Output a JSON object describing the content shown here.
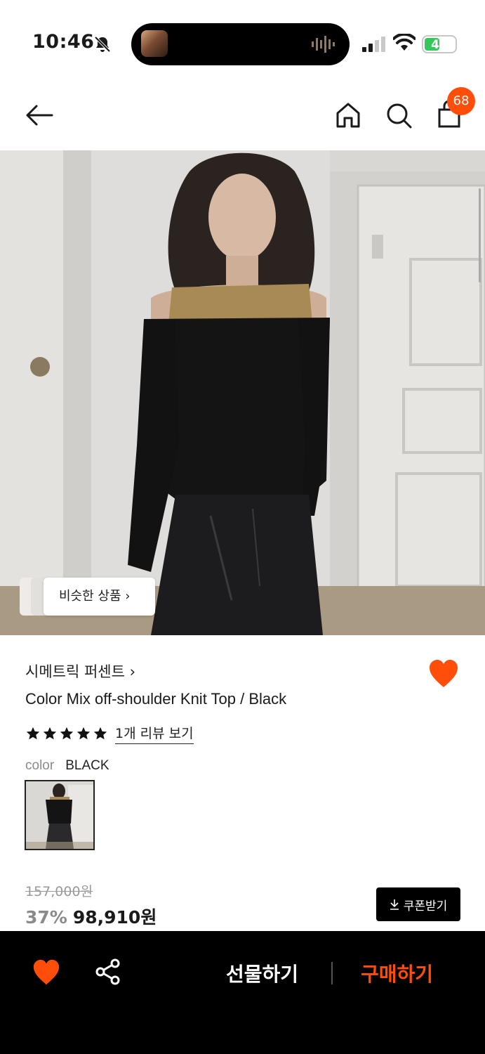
{
  "status_bar": {
    "time": "10:46",
    "battery_level": "49",
    "battery_fraction": 0.49
  },
  "header": {
    "cart_count": "68",
    "icons": [
      "back-arrow-icon",
      "home-icon",
      "search-icon",
      "shopping-bag-icon"
    ]
  },
  "hero": {
    "similar_products_label": "비슷한 상품"
  },
  "product": {
    "brand": "시메트릭 퍼센트",
    "title": "Color Mix off-shoulder Knit Top / Black",
    "rating_stars": 5,
    "review_link": "1개 리뷰 보기",
    "color_label": "color",
    "color_value": "BLACK",
    "original_price": "157,000원",
    "discount": "37%",
    "final_price": "98,910원",
    "coupon_label": "쿠폰받기"
  },
  "bottom_bar": {
    "gift_label": "선물하기",
    "buy_label": "구매하기"
  },
  "colors": {
    "accent": "#ff4d0a",
    "black": "#000000",
    "battery_green": "#34c759"
  }
}
